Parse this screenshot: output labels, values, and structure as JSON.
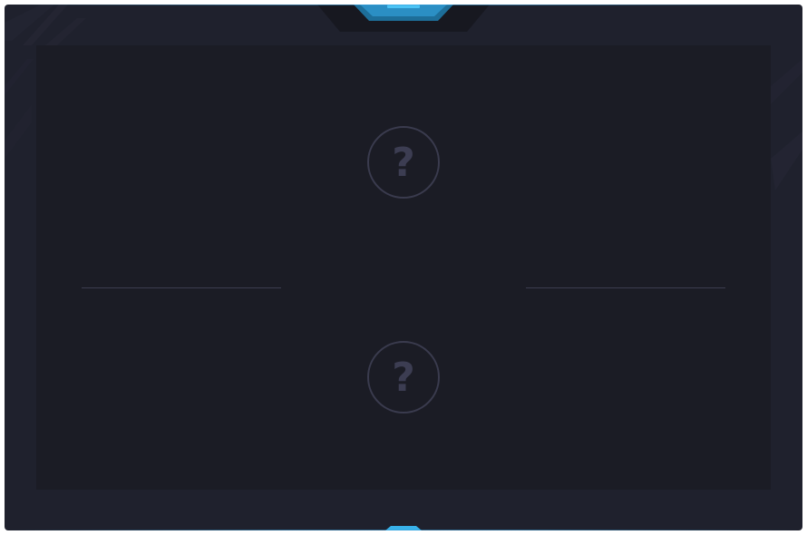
{
  "theme": {
    "frame_color": "#1f212d",
    "arena_color": "#1b1c25",
    "accent_color": "#38b2ea",
    "slot_outline_color": "#3a3b4e",
    "divider_color": "#3c3d50"
  },
  "top_slot": {
    "icon": "question-mark-icon",
    "glyph": "?"
  },
  "bottom_slot": {
    "icon": "question-mark-icon",
    "glyph": "?"
  }
}
